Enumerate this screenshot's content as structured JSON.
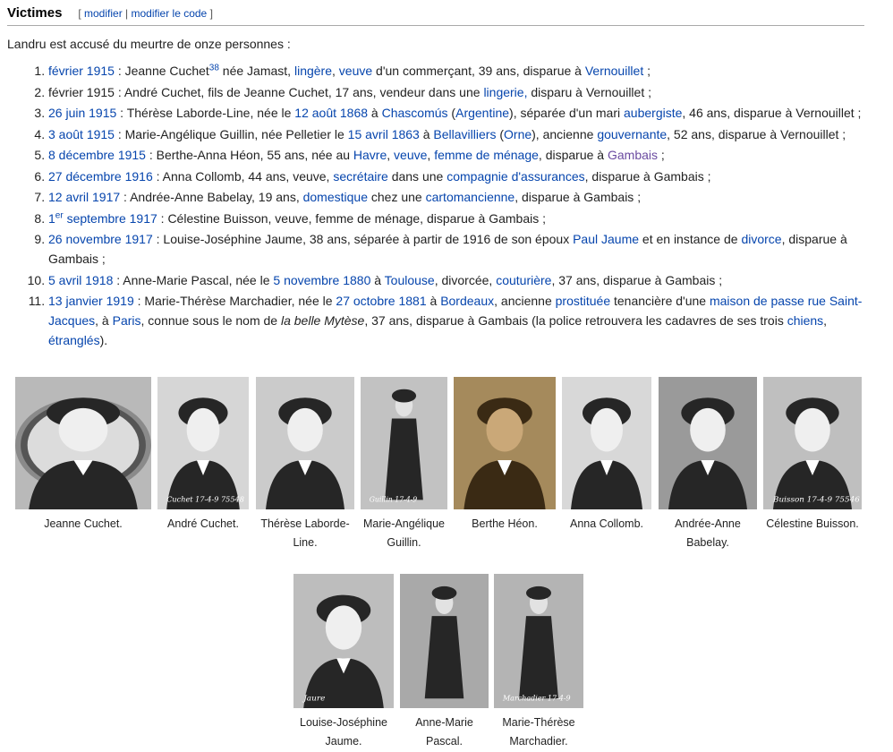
{
  "section": {
    "title": "Victimes",
    "edit_open": "[",
    "edit_label": "modifier",
    "edit_sep": "|",
    "edit_code_label": "modifier le code",
    "edit_close": "]"
  },
  "intro": "Landru est accusé du meurtre de onze personnes :",
  "victims": [
    {
      "parts": [
        {
          "t": "février 1915",
          "link": true
        },
        {
          "t": " : Jeanne Cuchet"
        },
        {
          "t": "38",
          "sup": true,
          "link": true
        },
        {
          "t": " née Jamast, "
        },
        {
          "t": "lingère",
          "link": true
        },
        {
          "t": ", "
        },
        {
          "t": "veuve",
          "link": true
        },
        {
          "t": " d'un commerçant, 39 ans, disparue à "
        },
        {
          "t": "Vernouillet",
          "link": true
        },
        {
          "t": " ;"
        }
      ]
    },
    {
      "parts": [
        {
          "t": "février 1915 : André Cuchet, fils de Jeanne Cuchet, 17 ans, vendeur dans une "
        },
        {
          "t": "lingerie,",
          "link": true
        },
        {
          "t": " disparu à Vernouillet ;"
        }
      ]
    },
    {
      "parts": [
        {
          "t": "26 juin 1915",
          "link": true
        },
        {
          "t": " : Thérèse Laborde-Line, née le "
        },
        {
          "t": "12 août 1868",
          "link": true
        },
        {
          "t": " à "
        },
        {
          "t": "Chascomús",
          "link": true
        },
        {
          "t": " ("
        },
        {
          "t": "Argentine",
          "link": true
        },
        {
          "t": "), séparée d'un mari "
        },
        {
          "t": "aubergiste",
          "link": true
        },
        {
          "t": ", 46 ans, disparue à Vernouillet ;"
        }
      ]
    },
    {
      "parts": [
        {
          "t": "3 août 1915",
          "link": true
        },
        {
          "t": " : Marie-Angélique Guillin, née Pelletier le "
        },
        {
          "t": "15 avril 1863",
          "link": true
        },
        {
          "t": " à "
        },
        {
          "t": "Bellavilliers",
          "link": true
        },
        {
          "t": " ("
        },
        {
          "t": "Orne",
          "link": true
        },
        {
          "t": "), ancienne "
        },
        {
          "t": "gouvernante",
          "link": true
        },
        {
          "t": ", 52 ans, disparue à Vernouillet ;"
        }
      ]
    },
    {
      "parts": [
        {
          "t": "8 décembre 1915",
          "link": true
        },
        {
          "t": " : Berthe-Anna Héon, 55 ans, née au "
        },
        {
          "t": "Havre",
          "link": true
        },
        {
          "t": ", "
        },
        {
          "t": "veuve",
          "link": true
        },
        {
          "t": ", "
        },
        {
          "t": "femme de ménage",
          "link": true
        },
        {
          "t": ", disparue à "
        },
        {
          "t": "Gambais",
          "link": true,
          "visited": true
        },
        {
          "t": " ;"
        }
      ]
    },
    {
      "parts": [
        {
          "t": "27 décembre 1916",
          "link": true
        },
        {
          "t": " : Anna Collomb, 44 ans, veuve, "
        },
        {
          "t": "secrétaire",
          "link": true
        },
        {
          "t": " dans une "
        },
        {
          "t": "compagnie d'assurances",
          "link": true
        },
        {
          "t": ", disparue à Gambais ;"
        }
      ]
    },
    {
      "parts": [
        {
          "t": "12 avril 1917",
          "link": true
        },
        {
          "t": " : Andrée-Anne Babelay, 19 ans, "
        },
        {
          "t": "domestique",
          "link": true
        },
        {
          "t": " chez une "
        },
        {
          "t": "cartomancienne",
          "link": true
        },
        {
          "t": ", disparue à Gambais ;"
        }
      ]
    },
    {
      "parts": [
        {
          "t": "1",
          "link": true
        },
        {
          "t": "er",
          "sup": true,
          "link": true
        },
        {
          "t": " septembre 1917",
          "link": true
        },
        {
          "t": " : Célestine Buisson, veuve, femme de ménage, disparue à Gambais ;"
        }
      ]
    },
    {
      "parts": [
        {
          "t": "26 novembre 1917",
          "link": true
        },
        {
          "t": " : Louise-Joséphine Jaume, 38 ans, séparée à partir de 1916 de son époux "
        },
        {
          "t": "Paul Jaume",
          "link": true
        },
        {
          "t": " et en instance de "
        },
        {
          "t": "divorce",
          "link": true
        },
        {
          "t": ", disparue à Gambais ;"
        }
      ]
    },
    {
      "parts": [
        {
          "t": "5 avril 1918",
          "link": true
        },
        {
          "t": " : Anne-Marie Pascal, née le "
        },
        {
          "t": "5 novembre 1880",
          "link": true
        },
        {
          "t": " à "
        },
        {
          "t": "Toulouse",
          "link": true
        },
        {
          "t": ", divorcée, "
        },
        {
          "t": "couturière",
          "link": true
        },
        {
          "t": ", 37 ans, disparue à Gambais ;"
        }
      ]
    },
    {
      "parts": [
        {
          "t": "13 janvier 1919",
          "link": true
        },
        {
          "t": " : Marie-Thérèse Marchadier, née le "
        },
        {
          "t": "27 octobre 1881",
          "link": true
        },
        {
          "t": " à "
        },
        {
          "t": "Bordeaux",
          "link": true
        },
        {
          "t": ", ancienne "
        },
        {
          "t": "prostituée",
          "link": true
        },
        {
          "t": " tenancière d'une "
        },
        {
          "t": "maison de passe",
          "link": true
        },
        {
          "t": " "
        },
        {
          "t": "rue Saint-Jacques",
          "link": true
        },
        {
          "t": ", à "
        },
        {
          "t": "Paris",
          "link": true
        },
        {
          "t": ", connue sous le nom de "
        },
        {
          "t": "la belle Mytèse",
          "italic": true
        },
        {
          "t": ", 37 ans, disparue à Gambais (la police retrouvera les cadavres de ses trois "
        },
        {
          "t": "chiens",
          "link": true
        },
        {
          "t": ", "
        },
        {
          "t": "étranglés",
          "link": true
        },
        {
          "t": ")."
        }
      ]
    }
  ],
  "gallery": [
    {
      "caption": "Jeanne Cuchet.",
      "bg": "#b9b9b9",
      "scan_text": ""
    },
    {
      "caption": "André Cuchet.",
      "bg": "#d6d6d6",
      "scan_text": "Cuchet  17-4-9  75548"
    },
    {
      "caption": "Thérèse Laborde-Line.",
      "bg": "#cbcbcb",
      "scan_text": ""
    },
    {
      "caption": "Marie-Angélique Guillin.",
      "bg": "#c2c2c2",
      "scan_text": "Guillin  17-4-9"
    },
    {
      "caption": "Berthe Héon.",
      "bg": "#a58a5c",
      "scan_text": ""
    },
    {
      "caption": "Anna Collomb.",
      "bg": "#d8d8d8",
      "scan_text": ""
    },
    {
      "caption": "Andrée-Anne Babelay.",
      "bg": "#9a9a9a",
      "scan_text": ""
    },
    {
      "caption": "Célestine Buisson.",
      "bg": "#bfbfbf",
      "scan_text": "Buisson  17-4-9  75546"
    },
    {
      "caption": "Louise-Joséphine Jaume.",
      "bg": "#bdbdbd",
      "scan_text": "Jaure"
    },
    {
      "caption": "Anne-Marie Pascal.",
      "bg": "#a9a9a9",
      "scan_text": ""
    },
    {
      "caption": "Marie-Thérèse Marchadier.",
      "bg": "#b4b4b4",
      "scan_text": "Marchadier  17-4-9"
    }
  ]
}
